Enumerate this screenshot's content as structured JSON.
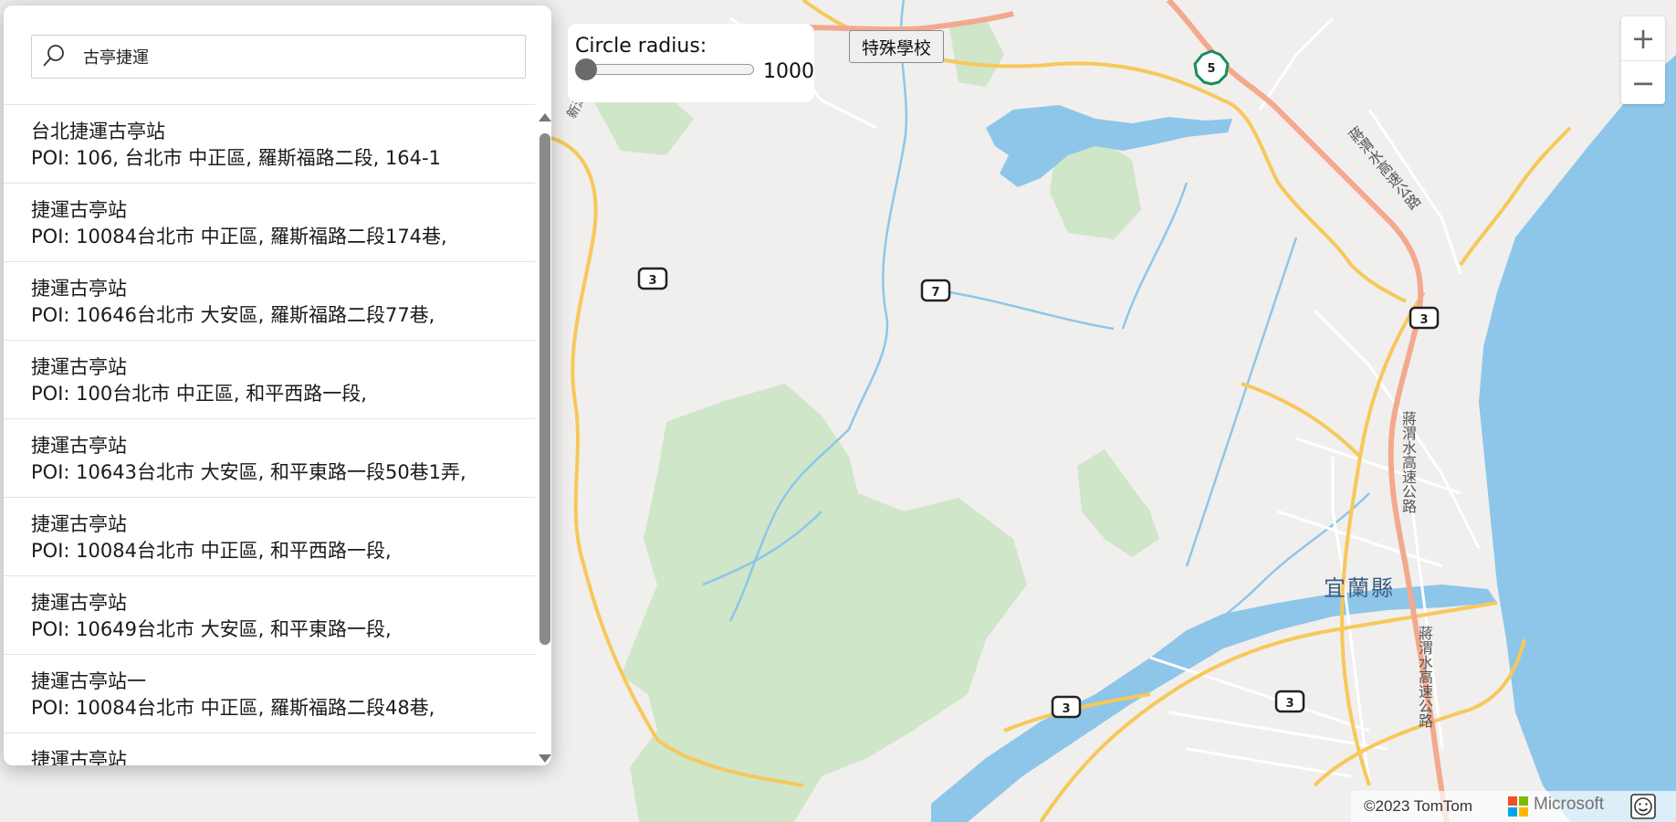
{
  "search": {
    "query": "古亭捷運"
  },
  "results": [
    {
      "name": "台北捷運古亭站",
      "address": "POI: 106, 台北市 中正區, 羅斯福路二段, 164-1"
    },
    {
      "name": "捷運古亭站",
      "address": "POI: 10084台北市 中正區, 羅斯福路二段174巷,"
    },
    {
      "name": "捷運古亭站",
      "address": "POI: 10646台北市 大安區, 羅斯福路二段77巷,"
    },
    {
      "name": "捷運古亭站",
      "address": "POI: 100台北市 中正區, 和平西路一段,"
    },
    {
      "name": "捷運古亭站",
      "address": "POI: 10643台北市 大安區, 和平東路一段50巷1弄,"
    },
    {
      "name": "捷運古亭站",
      "address": "POI: 10084台北市 中正區, 和平西路一段,"
    },
    {
      "name": "捷運古亭站",
      "address": "POI: 10649台北市 大安區, 和平東路一段,"
    },
    {
      "name": "捷運古亭站一",
      "address": "POI: 10084台北市 中正區, 羅斯福路二段48巷,"
    },
    {
      "name": "捷運古亭站",
      "address": ""
    }
  ],
  "radius": {
    "label": "Circle radius:",
    "value": "1000"
  },
  "school_button": {
    "label": "特殊學校"
  },
  "zoom": {
    "in_label": "+",
    "out_label": "−"
  },
  "map": {
    "labels": {
      "county": "宜蘭縣",
      "highway_top": "蔣渭水高速公路",
      "highway_mid": "蔣渭水高速公路",
      "highway_low": "蔣渭水高速公路",
      "road_left": "新潭路"
    },
    "shields": [
      {
        "text": "3"
      },
      {
        "text": "7"
      },
      {
        "text": "3"
      },
      {
        "text": "3"
      },
      {
        "text": "3"
      },
      {
        "text": "5"
      }
    ],
    "colors": {
      "land": "#f0efee",
      "water": "#8ec6ea",
      "forest": "#cfe6c9",
      "major_road": "#f7c85a",
      "highway": "#f3a98e",
      "minor_road": "#ffffff"
    }
  },
  "attribution": {
    "copyright": "©2023 TomTom",
    "brand": "Microsoft"
  }
}
